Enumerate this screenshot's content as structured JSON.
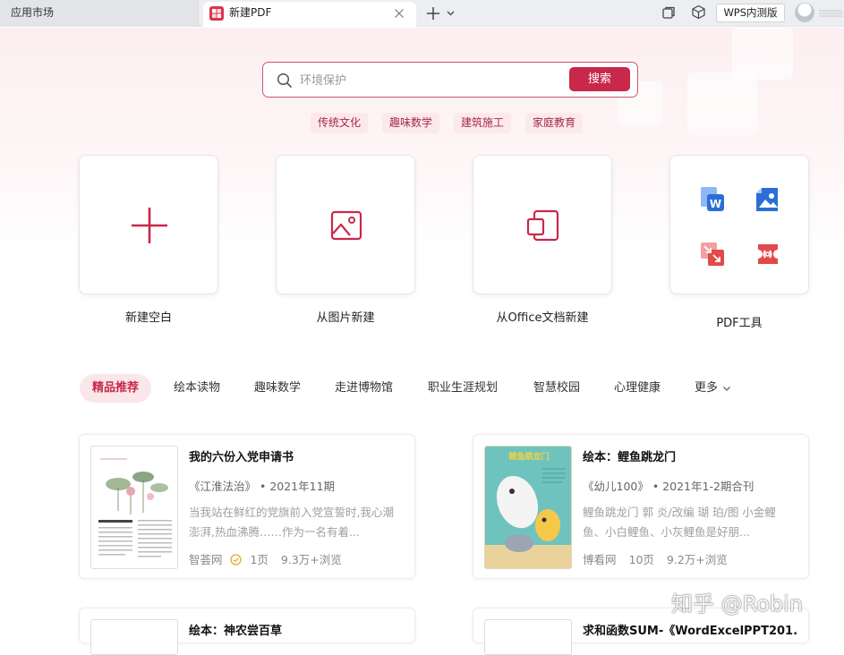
{
  "tabs": {
    "app_market": "应用市场",
    "active": "新建PDF",
    "badge": "WPS内测版"
  },
  "search": {
    "placeholder": "环境保护",
    "button": "搜索",
    "hot_tags": [
      "传统文化",
      "趣味数学",
      "建筑施工",
      "家庭教育"
    ]
  },
  "create": {
    "blank": "新建空白",
    "from_image": "从图片新建",
    "from_office": "从Office文档新建",
    "pdf_tools": "PDF工具"
  },
  "categories": [
    "精品推荐",
    "绘本读物",
    "趣味数学",
    "走进博物馆",
    "职业生涯规划",
    "智慧校园",
    "心理健康",
    "更多"
  ],
  "docs": [
    {
      "title": "我的六份入党申请书",
      "source": "《江淮法治》 • 2021年11期",
      "desc": "当我站在鲜红的党旗前入党宣誓时,我心潮澎湃,热血沸腾……作为一名有着...",
      "publisher": "智荟网",
      "pages": "1页",
      "views": "9.3万+浏览"
    },
    {
      "title": "绘本：鲤鱼跳龙门",
      "source": "《幼儿100》 • 2021年1-2期合刊",
      "desc": "鲤鱼跳龙门 郭 炎/改编 瑚 珀/图 小金鲤鱼、小白鲤鱼、小灰鲤鱼是好朋...",
      "publisher": "博看网",
      "pages": "10页",
      "views": "9.2万+浏览",
      "cover_text": "鲤鱼跳龙门"
    },
    {
      "title": "绘本：神农尝百草"
    },
    {
      "title": "求和函数SUM-《WordExcelPPT201..."
    }
  ],
  "watermark": "知乎 @Robin",
  "colors": {
    "accent": "#c8284a",
    "icon_blue": "#2b6fd6",
    "icon_red": "#e24a4a"
  }
}
